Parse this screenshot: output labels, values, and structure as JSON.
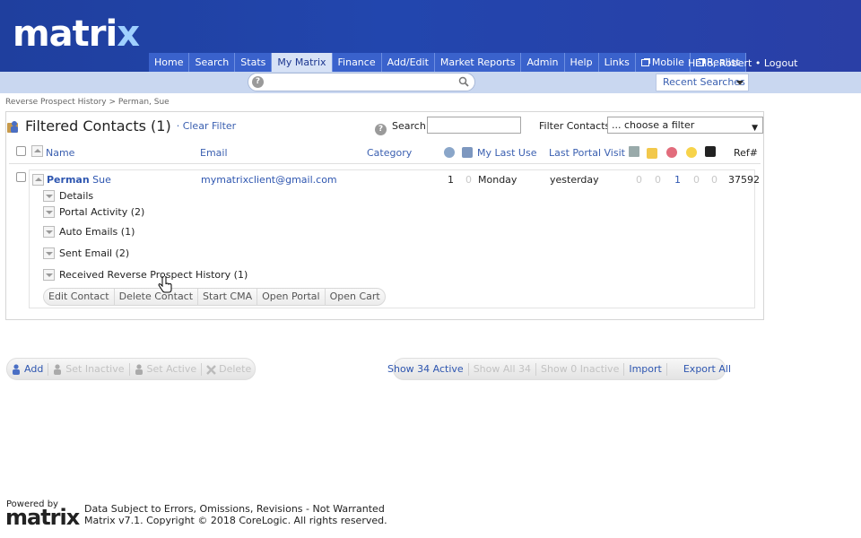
{
  "header": {
    "logo": "matrix",
    "greeting_prefix": "Hello, Robert",
    "logout": "Logout"
  },
  "nav": {
    "tabs": [
      "Home",
      "Search",
      "Stats",
      "My Matrix",
      "Finance",
      "Add/Edit",
      "Market Reports",
      "Admin",
      "Help",
      "Links",
      "Mobile",
      "Realist"
    ],
    "active": "My Matrix"
  },
  "search": {
    "recent": "Recent Searches",
    "label": "Search:",
    "value": ""
  },
  "breadcrumb": "Reverse Prospect History > Perman, Sue",
  "page": {
    "title": "Filtered Contacts (1)",
    "clear_filter": "· Clear Filter",
    "filter_label": "Filter Contacts:",
    "filter_value": "... choose a filter"
  },
  "table": {
    "headers": {
      "name": "Name",
      "email": "Email",
      "category": "Category",
      "last_use": "My Last Use",
      "portal": "Last Portal Visit",
      "ref": "Ref#"
    }
  },
  "contact": {
    "last": "Perman",
    "first": "Sue",
    "email": "mymatrixclient@gmail.com",
    "c1": "1",
    "c2": "0",
    "last_use": "Monday",
    "portal": "yesterday",
    "i1": "0",
    "i2": "0",
    "i3": "1",
    "i4": "0",
    "i5": "0",
    "ref": "37592",
    "sections": [
      "Details",
      "Portal Activity (2)",
      "Auto Emails (1)",
      "Sent Email (2)",
      "Received Reverse Prospect History (1)"
    ],
    "actions": [
      "Edit Contact",
      "Delete Contact",
      "Start CMA",
      "Open Portal",
      "Open Cart"
    ]
  },
  "bottom": {
    "left": [
      "Add",
      "Set Inactive",
      "Set Active",
      "Delete"
    ],
    "right": [
      "Show 34 Active",
      "Show All 34",
      "Show 0 Inactive",
      "Import",
      "Export All"
    ]
  },
  "footer": {
    "powered": "Powered by",
    "logo": "matrix",
    "line1": "Data Subject to Errors, Omissions, Revisions - Not Warranted",
    "line2": "Matrix v7.1. Copyright © 2018 CoreLogic. All rights reserved."
  },
  "colors": {
    "header": "#2246ae",
    "link": "#3a5fb0",
    "tab": "#3a62cc"
  }
}
